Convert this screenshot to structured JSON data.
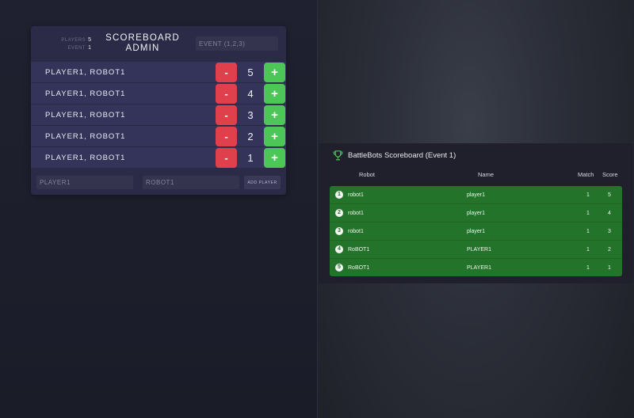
{
  "admin": {
    "stats": [
      {
        "label": "PLAYERS",
        "value": "5"
      },
      {
        "label": "EVENT",
        "value": "1"
      }
    ],
    "title": "SCOREBOARD ADMIN",
    "event_placeholder": "EVENT (1,2,3)",
    "minus_label": "-",
    "plus_label": "+",
    "rows": [
      {
        "name": "PLAYER1, ROBOT1",
        "score": "5"
      },
      {
        "name": "PLAYER1, ROBOT1",
        "score": "4"
      },
      {
        "name": "PLAYER1, ROBOT1",
        "score": "3"
      },
      {
        "name": "PLAYER1, ROBOT1",
        "score": "2"
      },
      {
        "name": "PLAYER1, ROBOT1",
        "score": "1"
      }
    ],
    "player_placeholder": "PLAYER1",
    "robot_placeholder": "ROBOT1",
    "add_button": "ADD PLAYER"
  },
  "scoreboard": {
    "title": "BattleBots Scoreboard (Event 1)",
    "trophy_icon": "trophy-icon",
    "columns": {
      "robot": "Robot",
      "name": "Name",
      "match": "Match",
      "score": "Score"
    },
    "rows": [
      {
        "rank": "1",
        "robot": "robot1",
        "name": "player1",
        "match": "1",
        "score": "5"
      },
      {
        "rank": "2",
        "robot": "robot1",
        "name": "player1",
        "match": "1",
        "score": "4"
      },
      {
        "rank": "3",
        "robot": "robot1",
        "name": "player1",
        "match": "1",
        "score": "3"
      },
      {
        "rank": "4",
        "robot": "RoBOT1",
        "name": "PLAYER1",
        "match": "1",
        "score": "2"
      },
      {
        "rank": "5",
        "robot": "RoBOT1",
        "name": "PLAYER1",
        "match": "1",
        "score": "1"
      }
    ]
  },
  "colors": {
    "minus": "#e0404c",
    "plus": "#4cc656",
    "board_body": "#23732a",
    "trophy": "#4cc656"
  }
}
